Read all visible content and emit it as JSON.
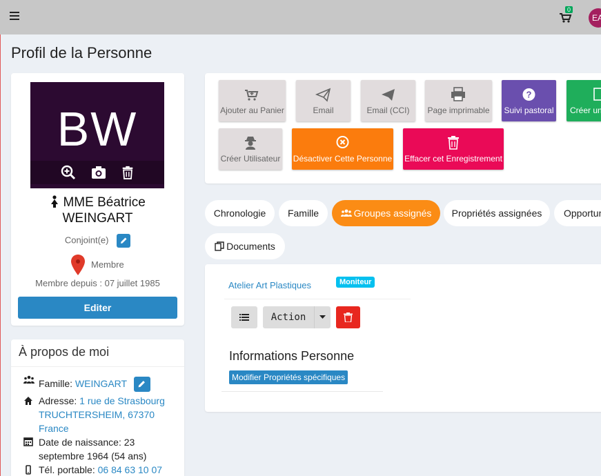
{
  "topbar": {
    "cart_count": "0",
    "user_initials": "EA"
  },
  "page": {
    "title": "Profil de la Personne"
  },
  "profile": {
    "initials": "BW",
    "name_line1": "MME Béatrice",
    "name_line2": "WEINGART",
    "role": "Conjoint(e)",
    "classification": "Membre",
    "member_since": "Membre depuis : 07 juillet 1985",
    "edit_label": "Editer"
  },
  "about": {
    "title": "À propos de moi",
    "family_label": "Famille: ",
    "family_value": "WEINGART",
    "address_label": "Adresse: ",
    "address_line1": "1 rue de Strasbourg",
    "address_line2": "TRUCHTERSHEIM, 67370",
    "address_line3": "France",
    "birth_label": "Date de naissance: 23",
    "birth_line2": "septembre 1964 (54 ans)",
    "mobile_label": "Tél. portable: ",
    "mobile_value": "06 84 63 10 07"
  },
  "actions": {
    "add_cart": "Ajouter au Panier",
    "email": "Email",
    "email_cci": "Email (CCI)",
    "printable": "Page imprimable",
    "pastoral": "Suivi pastoral",
    "create_partial": "Créer un",
    "create_user": "Créer Utilisateur",
    "deactivate": "Désactiver Cette Personne",
    "delete_record": "Effacer cet Enregistrement"
  },
  "tabs": {
    "timeline": "Chronologie",
    "family": "Famille",
    "groups": "Groupes assignés",
    "properties": "Propriétés assignées",
    "opportunities": "Opportun",
    "documents": "Documents"
  },
  "groups": {
    "group_name": "Atelier Art Plastiques",
    "group_role": "Moniteur",
    "action_label": "Action"
  },
  "info": {
    "title": "Informations Personne",
    "modify_label": "Modifier Propriétés spécifiques"
  },
  "colors": {
    "primary": "#2a88c4",
    "orange": "#fb7c0d",
    "pink": "#ea0a57",
    "purple": "#6a4fae",
    "green": "#1fae5b",
    "photo_bg": "#2c0a31"
  }
}
